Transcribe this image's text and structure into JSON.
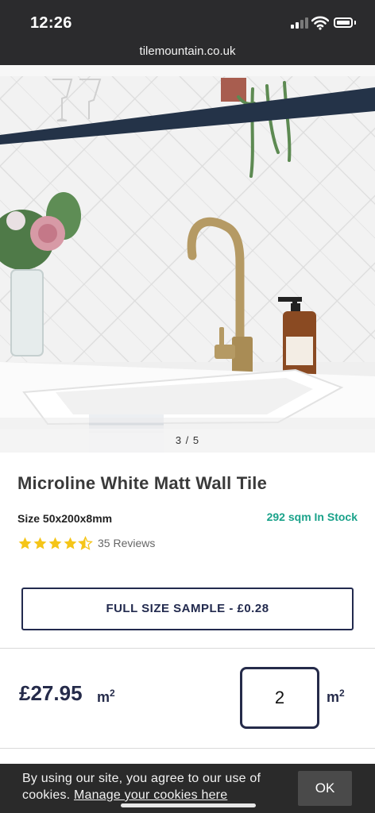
{
  "status_bar": {
    "time": "12:26"
  },
  "browser": {
    "url": "tilemountain.co.uk"
  },
  "gallery": {
    "counter": "3 / 5"
  },
  "product": {
    "title": "Microline White Matt Wall Tile",
    "size": "Size 50x200x8mm",
    "stock": "292 sqm In Stock",
    "rating": 4.5,
    "reviews": "35 Reviews",
    "sample_button": "FULL SIZE SAMPLE - £0.28",
    "price": "£27.95",
    "price_unit": "m",
    "price_unit_sup": "2",
    "quantity": "2",
    "quantity_unit": "m",
    "quantity_unit_sup": "2"
  },
  "cookie_bar": {
    "text": "By using our site, you agree to our use of cookies.",
    "link": "Manage your cookies here",
    "ok": "OK"
  },
  "colors": {
    "brand_navy": "#252b4a",
    "stock_green": "#1aa28a",
    "star_yellow": "#f5c518"
  }
}
